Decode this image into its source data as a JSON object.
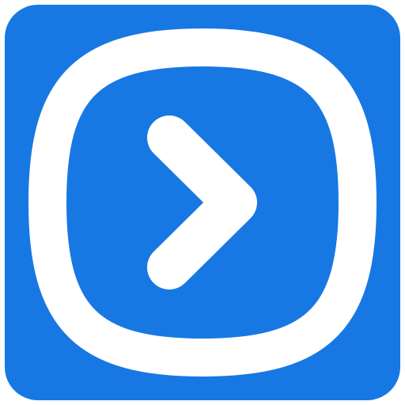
{
  "icon": {
    "name": "chevron-right-in-squircle",
    "background_color": "#1878E3",
    "foreground_color": "#FFFFFF"
  }
}
